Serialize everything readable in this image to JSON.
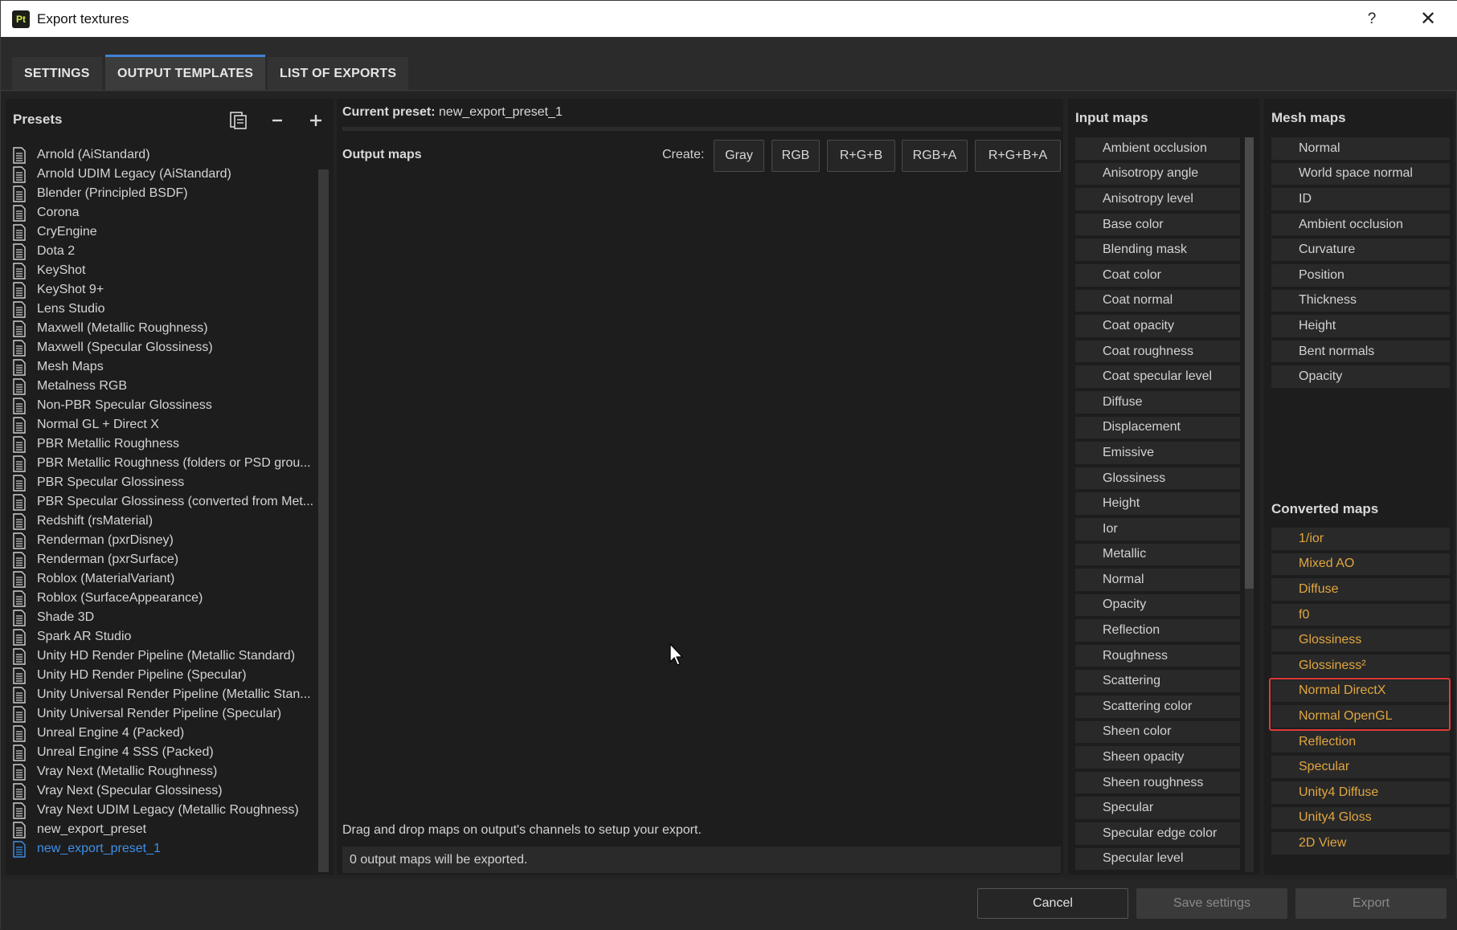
{
  "window": {
    "title": "Export textures",
    "app_icon": "Pt",
    "help": "?",
    "close": "✕"
  },
  "tabs": [
    {
      "label": "SETTINGS",
      "active": false
    },
    {
      "label": "OUTPUT TEMPLATES",
      "active": true
    },
    {
      "label": "LIST OF EXPORTS",
      "active": false
    }
  ],
  "presets": {
    "title": "Presets",
    "icons": [
      "duplicate-icon",
      "remove-icon",
      "add-icon"
    ],
    "items": [
      "Arnold (AiStandard)",
      "Arnold UDIM Legacy (AiStandard)",
      "Blender (Principled BSDF)",
      "Corona",
      "CryEngine",
      "Dota 2",
      "KeyShot",
      "KeyShot 9+",
      "Lens Studio",
      "Maxwell (Metallic Roughness)",
      "Maxwell (Specular Glossiness)",
      "Mesh Maps",
      "Metalness RGB",
      "Non-PBR Specular Glossiness",
      "Normal GL + Direct X",
      "PBR Metallic Roughness",
      "PBR Metallic Roughness (folders or PSD grou...",
      "PBR Specular Glossiness",
      "PBR Specular Glossiness (converted from Met...",
      "Redshift (rsMaterial)",
      "Renderman (pxrDisney)",
      "Renderman (pxrSurface)",
      "Roblox (MaterialVariant)",
      "Roblox (SurfaceAppearance)",
      "Shade 3D",
      "Spark AR Studio",
      "Unity HD Render Pipeline (Metallic Standard)",
      "Unity HD Render Pipeline (Specular)",
      "Unity Universal Render Pipeline (Metallic Stan...",
      "Unity Universal Render Pipeline (Specular)",
      "Unreal Engine 4 (Packed)",
      "Unreal Engine 4 SSS (Packed)",
      "Vray Next (Metallic Roughness)",
      "Vray Next (Specular Glossiness)",
      "Vray Next UDIM Legacy (Metallic Roughness)",
      "new_export_preset",
      "new_export_preset_1"
    ],
    "selected_index": 36
  },
  "center": {
    "current_preset_label": "Current preset:",
    "current_preset_value": "new_export_preset_1",
    "output_maps_title": "Output maps",
    "create_label": "Create:",
    "create_buttons": [
      "Gray",
      "RGB",
      "R+G+B",
      "RGB+A",
      "R+G+B+A"
    ],
    "hint": "Drag and drop maps on output's channels to setup your export.",
    "status": "0 output maps will be exported."
  },
  "input_maps": {
    "title": "Input maps",
    "items": [
      "Ambient occlusion",
      "Anisotropy angle",
      "Anisotropy level",
      "Base color",
      "Blending mask",
      "Coat color",
      "Coat normal",
      "Coat opacity",
      "Coat roughness",
      "Coat specular level",
      "Diffuse",
      "Displacement",
      "Emissive",
      "Glossiness",
      "Height",
      "Ior",
      "Metallic",
      "Normal",
      "Opacity",
      "Reflection",
      "Roughness",
      "Scattering",
      "Scattering color",
      "Sheen color",
      "Sheen opacity",
      "Sheen roughness",
      "Specular",
      "Specular edge color",
      "Specular level"
    ]
  },
  "mesh_maps": {
    "title": "Mesh maps",
    "items": [
      "Normal",
      "World space normal",
      "ID",
      "Ambient occlusion",
      "Curvature",
      "Position",
      "Thickness",
      "Height",
      "Bent normals",
      "Opacity"
    ]
  },
  "converted_maps": {
    "title": "Converted maps",
    "items": [
      "1/ior",
      "Mixed AO",
      "Diffuse",
      "f0",
      "Glossiness",
      "Glossiness²",
      "Normal DirectX",
      "Normal OpenGL",
      "Reflection",
      "Specular",
      "Unity4 Diffuse",
      "Unity4 Gloss",
      "2D View"
    ],
    "highlighted": [
      "Normal DirectX",
      "Normal OpenGL"
    ],
    "color": "#e0a640",
    "highlight_color": "#e03a3a"
  },
  "footer": {
    "cancel": "Cancel",
    "save": "Save settings",
    "export": "Export"
  }
}
